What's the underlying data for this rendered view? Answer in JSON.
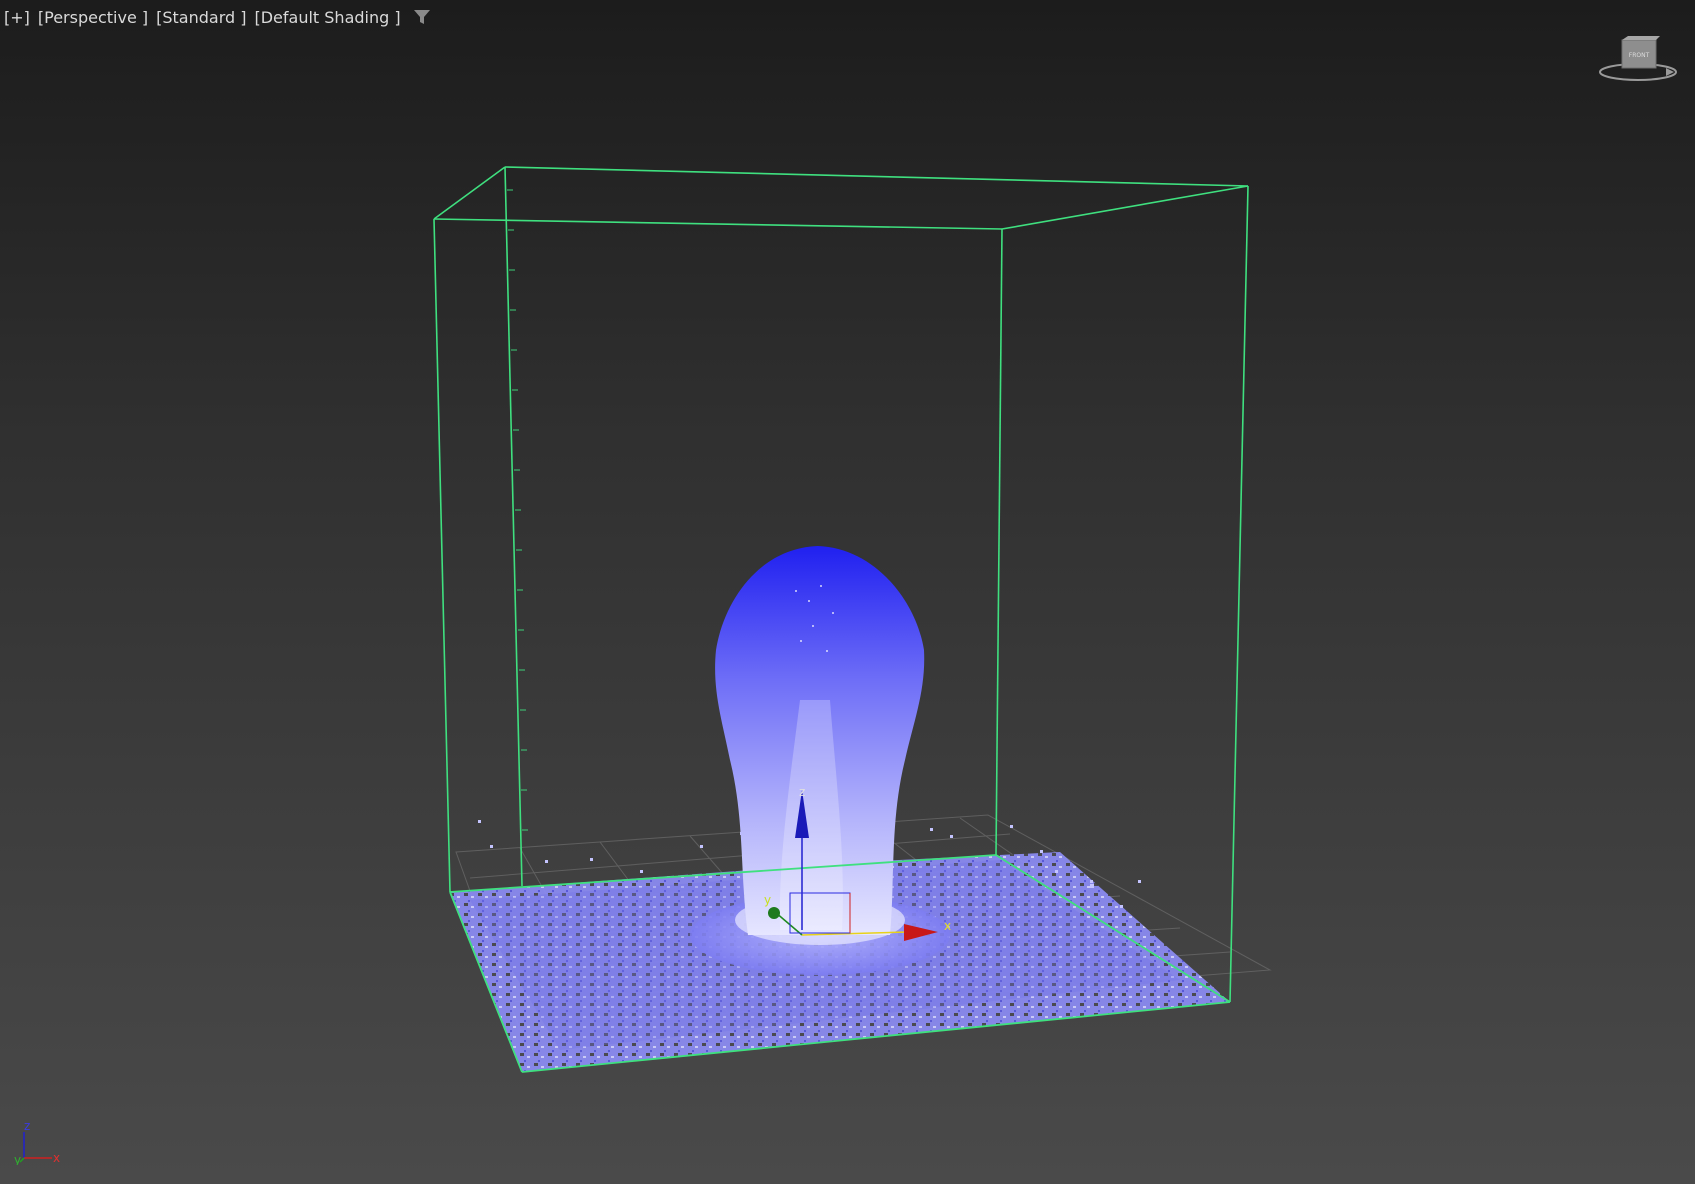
{
  "viewport": {
    "labels": {
      "plus": "[+]",
      "view": "[Perspective ]",
      "mode": "[Standard ]",
      "shading": "[Default Shading ]"
    },
    "filter_icon": "filter-funnel-icon",
    "viewcube_label": "FRONT",
    "gizmo": {
      "x_label": "x",
      "y_label": "y",
      "z_label": "z"
    },
    "tripod": {
      "x_label": "x",
      "y_label": "y",
      "z_label": "z"
    }
  },
  "colors": {
    "background_top": "#1c1c1c",
    "background_bottom": "#4a4a4a",
    "bounding_box": "#3fe07f",
    "particles_dark": "#2d2df0",
    "particles_light": "#c9c9ff",
    "axis_x": "#e02020",
    "axis_y": "#20a020",
    "axis_z": "#2020d0",
    "grid": "#7a7a7a"
  }
}
